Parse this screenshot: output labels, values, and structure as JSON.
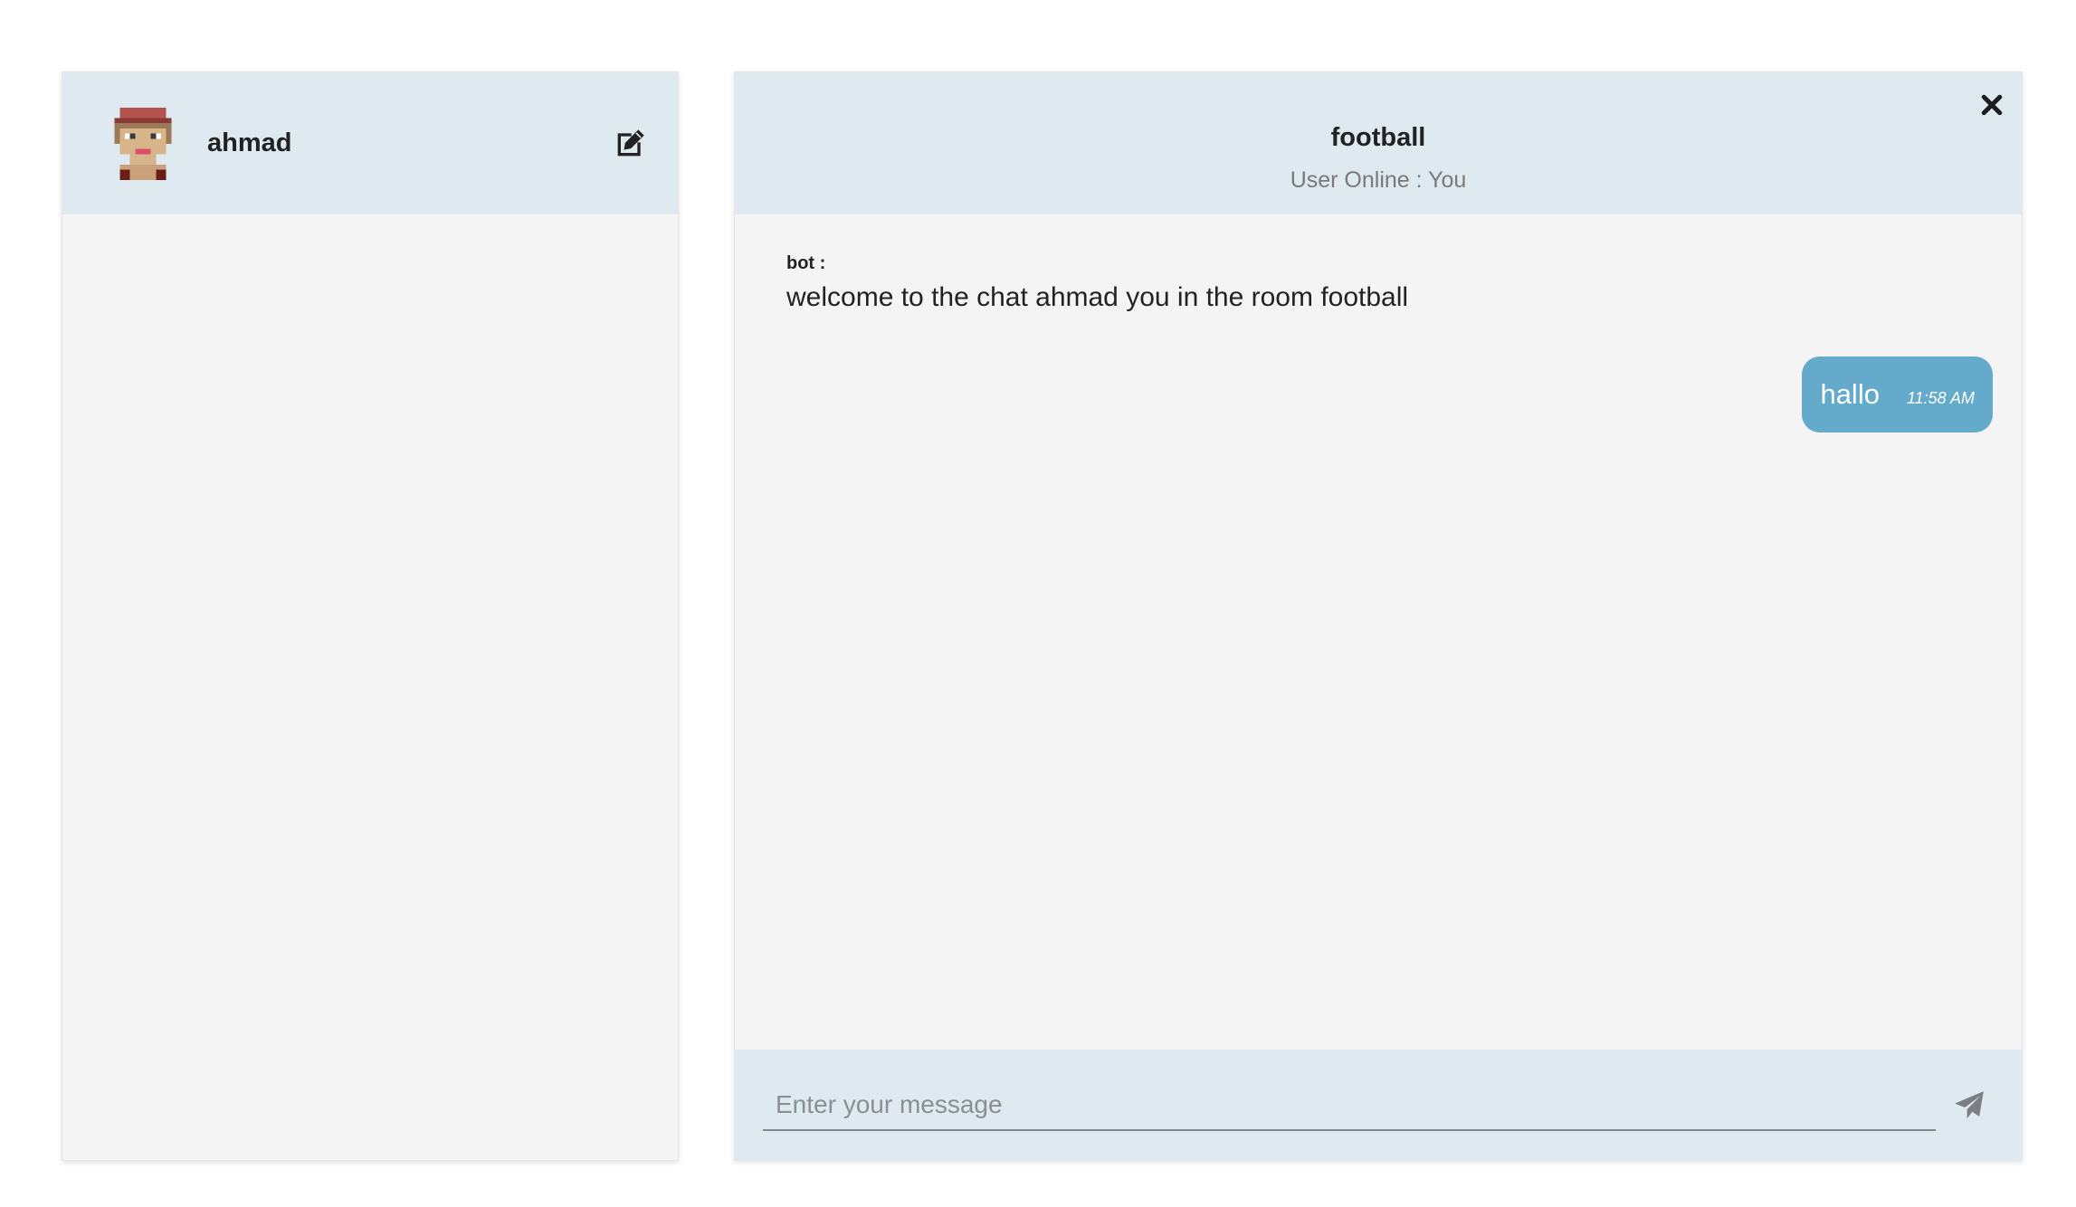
{
  "sidebar": {
    "username": "ahmad",
    "avatar_icon": "pixel-avatar-icon",
    "edit_icon": "edit-icon"
  },
  "chat": {
    "room_name": "football",
    "online_status": "User Online : You",
    "close_icon": "close-icon",
    "messages": [
      {
        "sender": "bot :",
        "text": "welcome to the chat ahmad you in the room football"
      },
      {
        "text": "hallo",
        "time": "11:58 AM"
      }
    ],
    "composer": {
      "placeholder": "Enter your message",
      "value": "",
      "send_icon": "send-icon"
    }
  },
  "colors": {
    "header_bg": "#dee9f0",
    "panel_bg": "#f4f4f4",
    "bubble_bg": "#64aacb"
  }
}
